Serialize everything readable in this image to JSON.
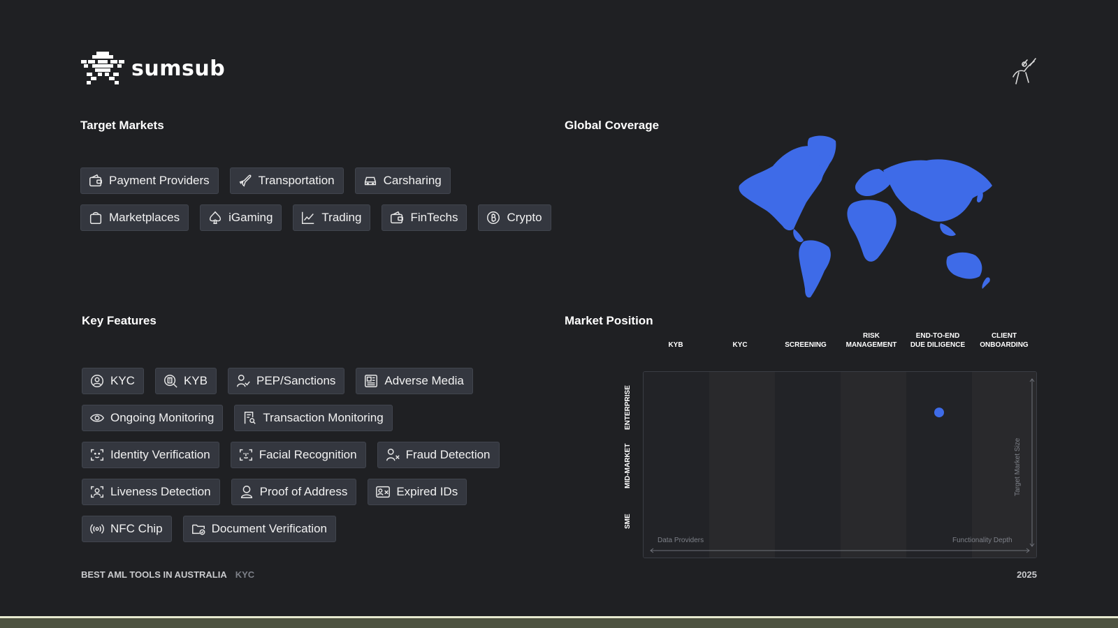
{
  "brand": {
    "name": "sumsub",
    "logo_icon": "sumsub-pixel-logo",
    "corner_icon": "rider-emblem"
  },
  "sections": {
    "target_markets": "Target Markets",
    "global_coverage": "Global Coverage",
    "key_features": "Key Features",
    "market_position": "Market Position"
  },
  "target_markets": [
    {
      "label": "Payment Providers",
      "icon": "wallet-icon"
    },
    {
      "label": "Transportation",
      "icon": "plane-icon"
    },
    {
      "label": "Carsharing",
      "icon": "car-icon"
    },
    {
      "label": "Marketplaces",
      "icon": "shopping-bag-icon"
    },
    {
      "label": "iGaming",
      "icon": "spade-icon"
    },
    {
      "label": "Trading",
      "icon": "chart-line-icon"
    },
    {
      "label": "FinTechs",
      "icon": "wallet-icon"
    },
    {
      "label": "Crypto",
      "icon": "bitcoin-icon"
    }
  ],
  "key_features": [
    {
      "label": "KYC",
      "icon": "user-circle-icon"
    },
    {
      "label": "KYB",
      "icon": "building-search-icon"
    },
    {
      "label": "PEP/Sanctions",
      "icon": "user-check-icon"
    },
    {
      "label": "Adverse Media",
      "icon": "newspaper-icon"
    },
    {
      "label": "Ongoing Monitoring",
      "icon": "eye-icon"
    },
    {
      "label": "Transaction Monitoring",
      "icon": "receipt-search-icon"
    },
    {
      "label": "Identity Verification",
      "icon": "face-scan-icon"
    },
    {
      "label": "Facial Recognition",
      "icon": "face-id-icon"
    },
    {
      "label": "Fraud Detection",
      "icon": "user-x-icon"
    },
    {
      "label": "Liveness Detection",
      "icon": "face-frame-icon"
    },
    {
      "label": "Proof of Address",
      "icon": "user-pin-icon"
    },
    {
      "label": "Expired IDs",
      "icon": "id-card-x-icon"
    },
    {
      "label": "NFC Chip",
      "icon": "nfc-icon"
    },
    {
      "label": "Document Verification",
      "icon": "folder-check-icon"
    }
  ],
  "market_position": {
    "columns": [
      "KYB",
      "KYC",
      "SCREENING",
      "RISK MANAGEMENT",
      "END-TO-END DUE DILIGENCE",
      "CLIENT ONBOARDING"
    ],
    "column_lines": [
      [
        "KYB"
      ],
      [
        "KYC"
      ],
      [
        "SCREENING"
      ],
      [
        "RISK",
        "MANAGEMENT"
      ],
      [
        "END-TO-END",
        "DUE DILIGENCE"
      ],
      [
        "CLIENT",
        "ONBOARDING"
      ]
    ],
    "rows": [
      "ENTERPRISE",
      "MID-MARKET",
      "SME"
    ],
    "x_axis_left": "Data Providers",
    "x_axis_right": "Functionality Depth",
    "y_axis": "Target Market Size",
    "marker": {
      "column": "END-TO-END DUE DILIGENCE",
      "row": "ENTERPRISE",
      "color": "#3e6be8"
    }
  },
  "footer": {
    "title": "BEST AML TOOLS IN AUSTRALIA",
    "tag": "KYC",
    "year": "2025"
  },
  "colors": {
    "background": "#1f2023",
    "chip": "#34373f",
    "accent": "#3e6be8"
  }
}
